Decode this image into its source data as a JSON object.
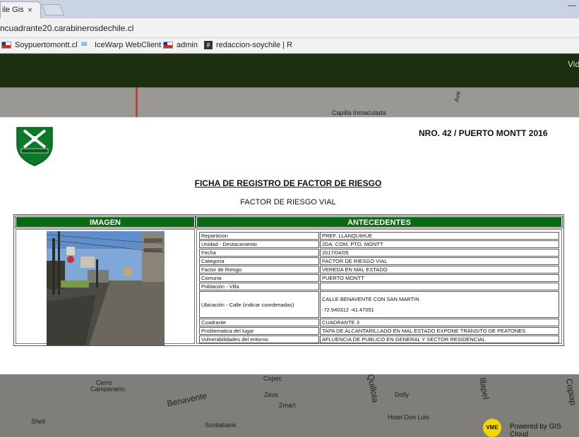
{
  "browser": {
    "tab_title": "ile Gis",
    "tab_close": "×",
    "url": "ncuadrante20.carabinerosdechile.cl",
    "minimize": "—",
    "bookmarks": [
      {
        "label": "Soypuertomontt.cl",
        "icon": "chile-flag-icon"
      },
      {
        "label": "IceWarp WebClient",
        "icon": "icewarp-icon"
      },
      {
        "label": "admin",
        "icon": "chile-flag-icon"
      },
      {
        "label": "redaccion-soychile | R",
        "icon": "hash-icon"
      }
    ]
  },
  "site": {
    "header_text": "Vid"
  },
  "map": {
    "labels": {
      "capilla": "Capilla Inmaculada",
      "cerro": "Cerro",
      "campanario": "Campanario",
      "benavente": "Benavente",
      "quillota": "Quillota",
      "illapel": "Illapel",
      "copiapo": "Copiap",
      "copec": "Copec",
      "zeus": "Zeus",
      "zmart": "Zmart",
      "dolly": "Dolly",
      "hotel": "Hotel Don Luis",
      "shell": "Shell",
      "scotiabank": "Scotiabank",
      "ave": "Ave"
    },
    "badge": "VME",
    "powered_by": "Powered by GIS Cloud"
  },
  "modal": {
    "logo_text": "ORDEN Y PATRIA",
    "nro": "NRO. 42 / PUERTO MONTT 2016",
    "title": "FICHA DE REGISTRO DE FACTOR DE RIESGO",
    "subtitle": "FACTOR DE RIESGO VIAL",
    "col_imagen": "IMAGEN",
    "col_antecedentes": "ANTECEDENTES",
    "rows": [
      {
        "key": "Reparticion",
        "value": "PREF. LLANQUIHUE"
      },
      {
        "key": "Unidad - Destacamento",
        "value": "2DA. COM. PTO. MONTT"
      },
      {
        "key": "Fecha",
        "value": "2017/04/05"
      },
      {
        "key": "Categoria",
        "value": "FACTOR DE RIESGO VIAL"
      },
      {
        "key": "Factor de Riesgo",
        "value": "VEREDA EN MAL ESTADO"
      },
      {
        "key": "Comuna",
        "value": "PUERTO MONTT"
      },
      {
        "key": "Población - Villa",
        "value": ""
      },
      {
        "key": "Ubicación - Calle (indicar coordenadas)",
        "value": "CALLE BENAVENTE CON SAN MARTIN",
        "value2": "-72.940312 -41.47051"
      },
      {
        "key": "Cuadrante",
        "value": "CUADRANTE 3"
      },
      {
        "key": "Problematica del lugar",
        "value": "TAPA DE ALCANTARILLADO EN MAL ESTADO EXPONE TRANSITO DE PEATONES"
      },
      {
        "key": "Vulnerabilidades del entorno",
        "value": "AFLUENCIA DE PUBLICO EN GENERAL Y SECTOR RESIDENCIAL"
      }
    ]
  }
}
